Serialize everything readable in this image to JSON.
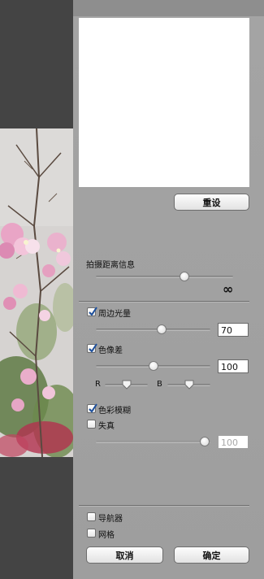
{
  "buttons": {
    "reset": "重设",
    "cancel": "取消",
    "ok": "确定"
  },
  "distance": {
    "label": "拍摄距离信息",
    "value_symbol": "∞",
    "slider_level": 0.66
  },
  "vignetting": {
    "label": "周边光量",
    "checked": true,
    "value": "70",
    "slider_level": 0.57
  },
  "chromatic": {
    "label": "色像差",
    "checked": true,
    "value": "100",
    "slider_level": 0.5,
    "r_label": "R",
    "b_label": "B",
    "r_level": 0.5,
    "b_level": 0.5
  },
  "color_blur": {
    "label": "色彩模糊",
    "checked": true
  },
  "distortion": {
    "label": "失真",
    "checked": false,
    "value": "100",
    "slider_level": 1.0
  },
  "navigator": {
    "label": "导航器",
    "checked": false
  },
  "grid": {
    "label": "网格",
    "checked": false
  },
  "colors": {
    "panel": "#9f9f9f",
    "preview_bg": "#444444",
    "field": "#ffffff"
  }
}
